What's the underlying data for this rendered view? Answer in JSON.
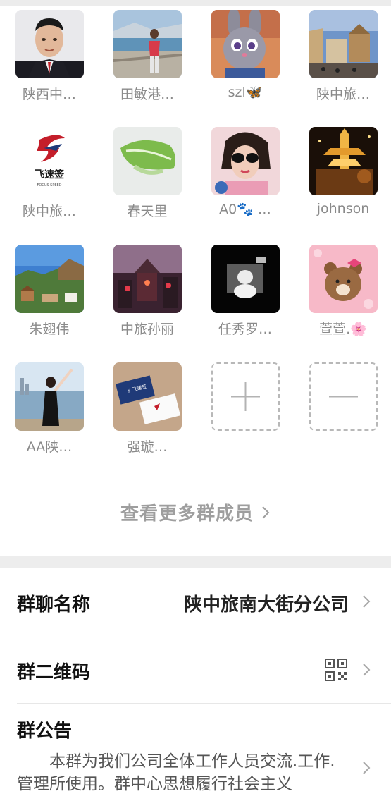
{
  "members": [
    {
      "name": "陕西中…",
      "avatar": "portrait-man-avatar"
    },
    {
      "name": "田敏港…",
      "avatar": "lake-woman-avatar"
    },
    {
      "name": "szl🦋",
      "avatar": "cartoon-rabbit-avatar"
    },
    {
      "name": "陕中旅…",
      "avatar": "plaza-avatar"
    },
    {
      "name": "陕中旅…",
      "avatar": "focus-speed-logo-avatar"
    },
    {
      "name": "春天里",
      "avatar": "green-leaf-avatar"
    },
    {
      "name": "A0🐾 …",
      "avatar": "sunglasses-woman-avatar"
    },
    {
      "name": "johnson",
      "avatar": "night-temple-avatar"
    },
    {
      "name": "朱翅伟",
      "avatar": "mountain-village-avatar"
    },
    {
      "name": "中旅孙丽",
      "avatar": "pink-city-avatar"
    },
    {
      "name": "任秀罗…",
      "avatar": "white-figure-avatar"
    },
    {
      "name": "萱萱.🌸",
      "avatar": "brown-bear-avatar"
    },
    {
      "name": "AA陕…",
      "avatar": "dancer-woman-avatar"
    },
    {
      "name": "强璇…",
      "avatar": "business-card-avatar"
    }
  ],
  "actions": {
    "add_label": "add-member",
    "remove_label": "remove-member"
  },
  "more_members": "查看更多群成员",
  "settings": {
    "group_name_label": "群聊名称",
    "group_name_value": "陕中旅南大街分公司",
    "qr_label": "群二维码",
    "notice_label": "群公告",
    "notice_text": "本群为我们公司全体工作人员交流.工作.管理所使用。群中心思想履行社会主义"
  },
  "colors": {
    "text_gray": "#8a8a8a",
    "divider": "#e7e7e7",
    "band": "#ededed"
  }
}
